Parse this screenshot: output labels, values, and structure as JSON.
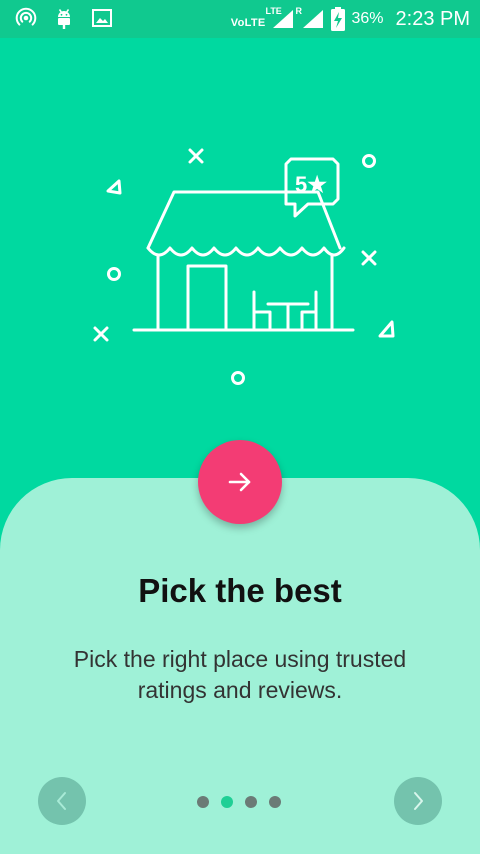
{
  "status_bar": {
    "left_icons": [
      "hotspot-icon",
      "android-icon",
      "image-icon"
    ],
    "volte": "VoLTE",
    "signal1_tag": "LTE",
    "signal2_tag": "R",
    "battery": "36%",
    "time": "2:23 PM"
  },
  "hero": {
    "rating_badge": "5★"
  },
  "onboarding": {
    "title": "Pick the best",
    "description": "Pick the right place using trusted ratings and reviews.",
    "page_index": 2,
    "page_count": 4
  },
  "colors": {
    "background": "#00d9a0",
    "status_bar": "#10c98f",
    "card": "#9ff1d7",
    "fab": "#f33c74",
    "active_dot": "#1fcf95"
  }
}
